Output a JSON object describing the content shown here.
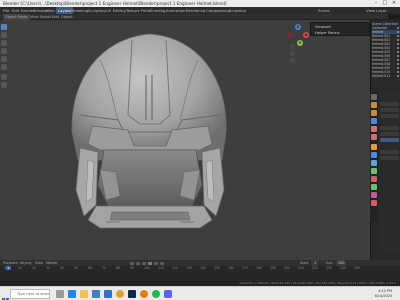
{
  "window": {
    "title": "Blender [C:\\Users\\...\\Desktop\\Blender\\project 1 Engineer Helmet\\Blender\\project 1 Engineer Helmet.blend]",
    "controls": [
      "–",
      "□",
      "✕"
    ]
  },
  "menubar": {
    "items": [
      "File",
      "Edit",
      "Render",
      "Window",
      "Help",
      "Layout",
      "Modeling",
      "Sculpting",
      "UV Editing",
      "Texture Paint",
      "Shading",
      "Animation",
      "Rendering",
      "Compositing",
      "Scripting"
    ],
    "active_workspace": "Layout",
    "scene_label": "Scene",
    "view_layer_label": "View Layer"
  },
  "header": {
    "mode": "Object Mode",
    "items": [
      "View",
      "Select",
      "Add",
      "Object"
    ]
  },
  "viewport": {
    "popup_rows": [
      "Viewport",
      "Helper Panels"
    ],
    "background": "#3e3e3e",
    "model_color": "#a9a9a9"
  },
  "outliner": {
    "rows": [
      "Scene Collection",
      "Collection",
      "Helmet",
      "Helmet.001",
      "Helmet.002",
      "Helmet.003",
      "Helmet.004",
      "Helmet.005",
      "Helmet.006",
      "Helmet.007",
      "Helmet.008",
      "Helmet.009",
      "Helmet.010",
      "Helmet.011"
    ],
    "selected_index": 2
  },
  "timeline": {
    "menus": [
      "Playback",
      "Keying",
      "View",
      "Marker"
    ],
    "ticks": [
      "0",
      "10",
      "20",
      "30",
      "40",
      "50",
      "60",
      "70",
      "80",
      "90",
      "100",
      "110",
      "120",
      "130",
      "140",
      "150",
      "160",
      "170",
      "180",
      "190",
      "200",
      "210",
      "220",
      "230",
      "240",
      "250"
    ],
    "current_frame": "1",
    "start_label": "Start",
    "start": "1",
    "end_label": "End",
    "end": "250"
  },
  "status": {
    "text": "Collection | Helmet | Verts:81,120 | Faces:80,960 | Tris:161,920 | Objects:0/12 | Mem: 128.4 MiB | 2.83.0"
  },
  "taskbar": {
    "search_placeholder": "Type here to search",
    "time": "4:12 PM",
    "date": "6/14/2020",
    "icons": [
      "task-view-icon",
      "edge-icon",
      "file-explorer-icon",
      "store-icon",
      "mail-icon",
      "chrome-icon",
      "photoshop-icon",
      "blender-icon",
      "spotify-icon",
      "discord-icon"
    ]
  },
  "colors": {
    "accent": "#5680c2",
    "gizmo_x": "#e0474f",
    "gizmo_y": "#8ac23d",
    "gizmo_z": "#4a8ae0"
  }
}
